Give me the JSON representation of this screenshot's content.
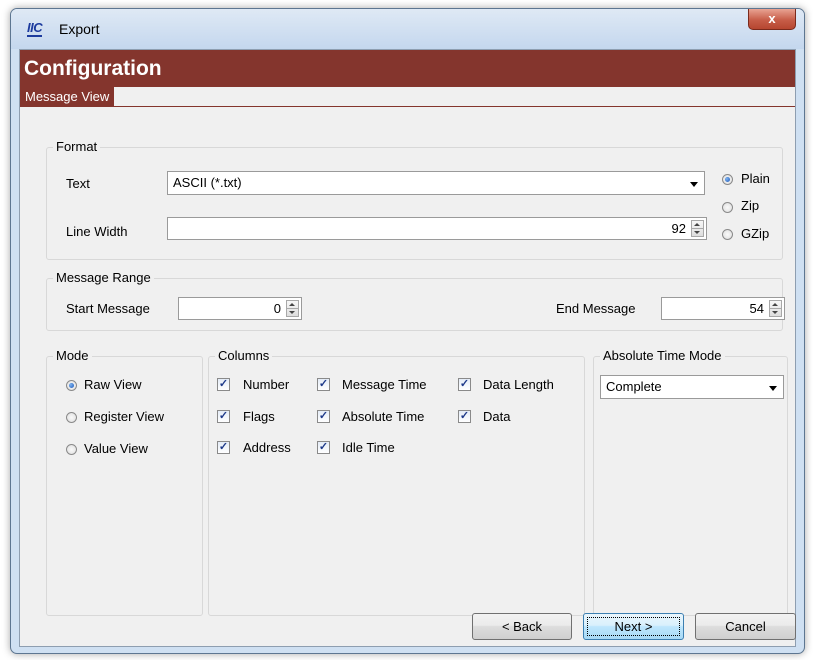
{
  "window": {
    "title": "Export",
    "app_icon_text": "IIC",
    "close_symbol": "x"
  },
  "header": {
    "title": "Configuration",
    "tab": "Message View"
  },
  "format": {
    "group_title": "Format",
    "text_label": "Text",
    "text_value": "ASCII (*.txt)",
    "line_width_label": "Line Width",
    "line_width_value": "92",
    "compression": [
      {
        "label": "Plain",
        "selected": true
      },
      {
        "label": "Zip",
        "selected": false
      },
      {
        "label": "GZip",
        "selected": false
      }
    ]
  },
  "message_range": {
    "group_title": "Message Range",
    "start_label": "Start Message",
    "start_value": "0",
    "end_label": "End Message",
    "end_value": "54"
  },
  "mode": {
    "group_title": "Mode",
    "options": [
      {
        "label": "Raw View",
        "selected": true
      },
      {
        "label": "Register View",
        "selected": false
      },
      {
        "label": "Value View",
        "selected": false
      }
    ]
  },
  "columns": {
    "group_title": "Columns",
    "items": [
      {
        "label": "Number",
        "checked": true
      },
      {
        "label": "Message Time",
        "checked": true
      },
      {
        "label": "Data Length",
        "checked": true
      },
      {
        "label": "Flags",
        "checked": true
      },
      {
        "label": "Absolute Time",
        "checked": true
      },
      {
        "label": "Data",
        "checked": true
      },
      {
        "label": "Address",
        "checked": true
      },
      {
        "label": "Idle Time",
        "checked": true
      }
    ]
  },
  "absolute_time_mode": {
    "group_title": "Absolute Time Mode",
    "value": "Complete"
  },
  "buttons": {
    "back": "< Back",
    "next": "Next >",
    "cancel": "Cancel"
  },
  "colors": {
    "header_bg": "#84352d",
    "window_frame": "#cfe0f2",
    "client_bg": "#f0f0f0"
  },
  "icons": {
    "check_glyph": "✓"
  }
}
